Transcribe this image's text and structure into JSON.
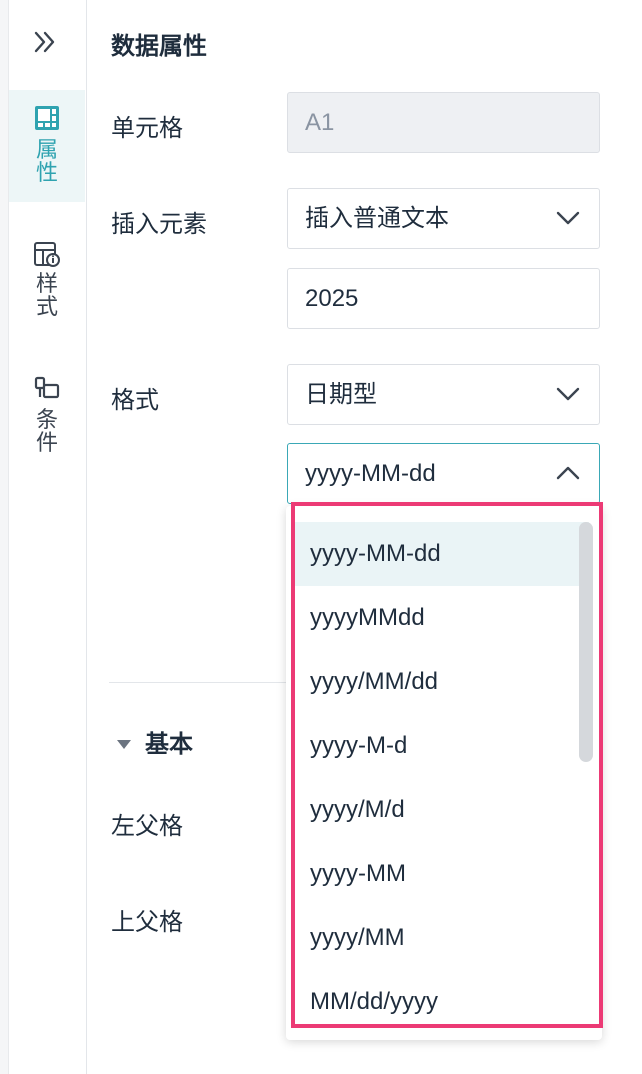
{
  "sidebar": {
    "items": [
      {
        "label": "属\n性",
        "icon": "properties-icon",
        "active": true
      },
      {
        "label": "样\n式",
        "icon": "style-icon",
        "active": false
      },
      {
        "label": "条\n件",
        "icon": "condition-icon",
        "active": false
      }
    ]
  },
  "panel": {
    "title": "数据属性",
    "cell_label": "单元格",
    "cell_value": "A1",
    "insert_label": "插入元素",
    "insert_value": "插入普通文本",
    "text_value": "2025",
    "format_label": "格式",
    "format_type": "日期型",
    "date_format": "yyyy-MM-dd",
    "section_basic": "基本",
    "left_parent_label": "左父格",
    "top_parent_label": "上父格"
  },
  "dropdown": {
    "options": [
      "yyyy-MM-dd",
      "yyyyMMdd",
      "yyyy/MM/dd",
      "yyyy-M-d",
      "yyyy/M/d",
      "yyyy-MM",
      "yyyy/MM",
      "MM/dd/yyyy"
    ],
    "selected": "yyyy-MM-dd"
  },
  "colors": {
    "accent": "#2fa3b0",
    "highlight": "#ec3a75",
    "selected_bg": "#eaf4f6"
  }
}
